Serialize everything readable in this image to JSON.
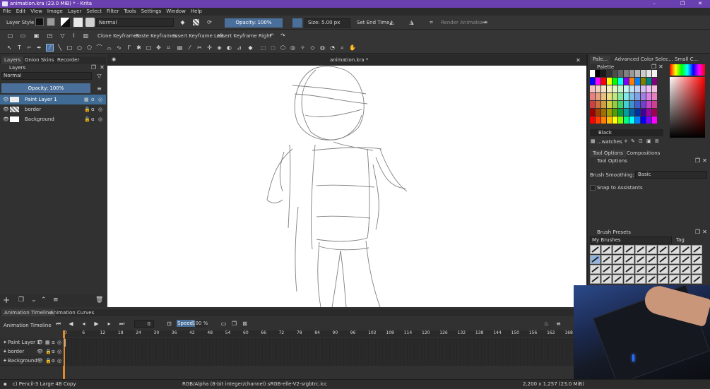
{
  "window": {
    "title": "animation.kra (23.0 MiB)  * - Krita",
    "minimize": "–",
    "maximize": "❐",
    "close": "✕"
  },
  "menu": [
    "File",
    "Edit",
    "View",
    "Image",
    "Layer",
    "Select",
    "Filter",
    "Tools",
    "Settings",
    "Window",
    "Help"
  ],
  "toolbar": {
    "layer_style": "Layer Style",
    "blend_mode": "Normal",
    "opacity": "Opacity: 100%",
    "size": "Size: 5.00 px",
    "set_end_time": "Set End Time",
    "render_animation": "Render Animation"
  },
  "keyframes_bar": {
    "clone": "Clone Keyframes",
    "paste": "Paste Keyframes",
    "insert_left": "Insert Keyframe Left",
    "insert_right": "Insert Keyframe Right"
  },
  "left_docker": {
    "tabs": [
      "Layers",
      "Onion Skins",
      "Recorder"
    ],
    "title": "Layers",
    "blend_mode": "Normal",
    "opacity": "Opacity:  100%",
    "layers": [
      {
        "name": "Paint Layer 1",
        "selected": true
      },
      {
        "name": "border",
        "selected": false
      },
      {
        "name": "Background",
        "selected": false
      }
    ]
  },
  "document_tab": "animation.kra *",
  "right_docker": {
    "tabs": [
      "Pale...",
      "Advanced Color Selec...",
      "Small C..."
    ],
    "palette_title": "Palette",
    "color_name": "Black",
    "swatches_label": "...watches",
    "option_tabs": [
      "Tool Options",
      "Compositions"
    ],
    "tool_options_title": "Tool Options",
    "brush_smoothing_label": "Brush Smoothing:",
    "brush_smoothing_value": "Basic",
    "snap_label": "Snap to Assistants",
    "brush_presets_title": "Brush Presets",
    "brush_presets_group": "My Brushes",
    "tag_label": "Tag"
  },
  "timeline": {
    "tabs": [
      "Animation Timeline",
      "Animation Curves"
    ],
    "title": "Animation Timeline",
    "frame": "0",
    "speed_label": "Speed:",
    "speed_value": "100 %",
    "ruler": [
      "0",
      "6",
      "12",
      "18",
      "24",
      "30",
      "36",
      "42",
      "48",
      "54",
      "60",
      "66",
      "72",
      "78",
      "84",
      "90",
      "96",
      "102",
      "108",
      "114",
      "120",
      "126",
      "132",
      "138",
      "144",
      "150",
      "156",
      "162",
      "168"
    ],
    "rows": [
      "Paint Layer 1",
      "border",
      "Background"
    ]
  },
  "status": {
    "brush": "c) Pencil-3 Large 4B Copy",
    "color_space": "RGB/Alpha (8-bit integer/channel)  sRGB-elle-V2-srgbtrc.icc",
    "dimensions": "2,200 x 1,257 (23.0 MiB)"
  },
  "palette_colors": [
    "#ffffff",
    "#000000",
    "#1a1a1a",
    "#333333",
    "#4d4d4d",
    "#666666",
    "#808080",
    "#999999",
    "#b3b3b3",
    "#cccccc",
    "#e6e6e6",
    "#f2f2f2",
    "#0000ff",
    "#ff00ff",
    "#ff0000",
    "#ffff00",
    "#00ff00",
    "#00ffff",
    "#8000ff",
    "#ff8000",
    "#0080ff",
    "#808000",
    "#008080",
    "#800080",
    "#f5c0c0",
    "#f5d0c0",
    "#f5e0c0",
    "#f5f0c0",
    "#e0f5c0",
    "#c0f5d0",
    "#c0f5f0",
    "#c0e0f5",
    "#c0d0f5",
    "#d0c0f5",
    "#f0c0f5",
    "#f5c0e0",
    "#e88080",
    "#e8a080",
    "#e8c080",
    "#e8e080",
    "#c0e880",
    "#80e8a0",
    "#80e8e8",
    "#80c0e8",
    "#80a0e8",
    "#a080e8",
    "#e080e8",
    "#e880c0",
    "#d04040",
    "#d07040",
    "#d0a040",
    "#d0d040",
    "#90d040",
    "#40d070",
    "#40d0d0",
    "#4090d0",
    "#4060d0",
    "#7040d0",
    "#d040d0",
    "#d04090",
    "#a00000",
    "#a04000",
    "#a07000",
    "#a0a000",
    "#50a000",
    "#00a040",
    "#00a0a0",
    "#0060a0",
    "#0030a0",
    "#4000a0",
    "#a000a0",
    "#a00050",
    "#fe0000",
    "#ff4000",
    "#ff8000",
    "#ffc000",
    "#ffff00",
    "#80ff00",
    "#00ff80",
    "#00ffff",
    "#0080ff",
    "#0000ff",
    "#8000ff",
    "#ff00ff"
  ]
}
